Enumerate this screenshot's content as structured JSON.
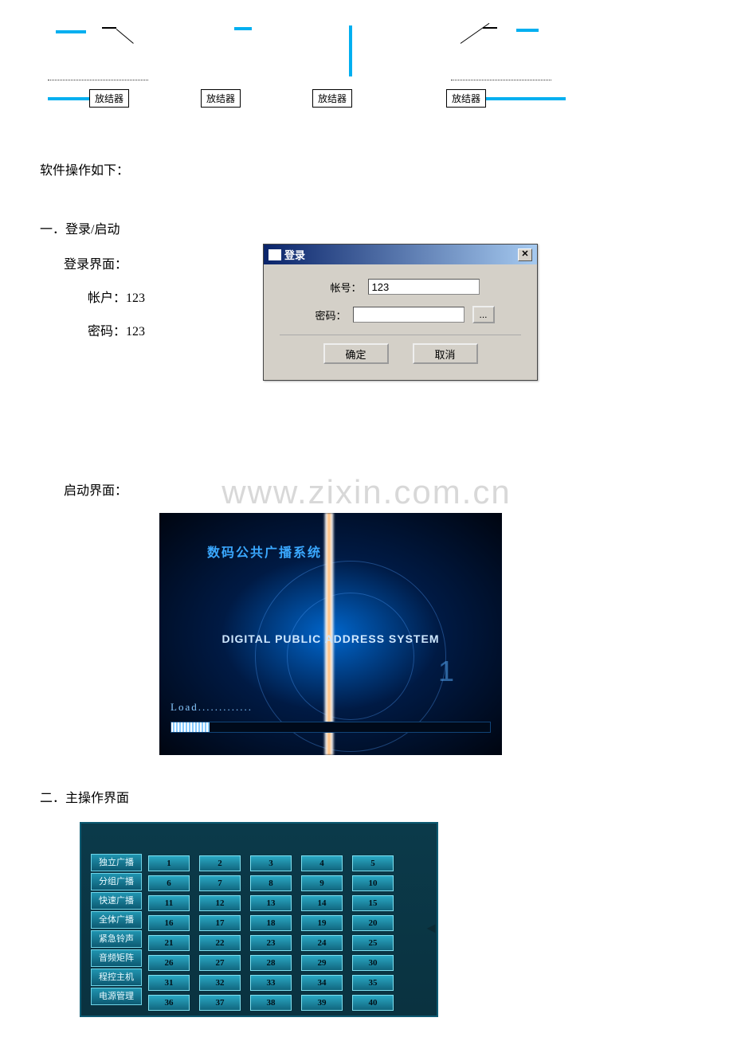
{
  "diagram": {
    "box_label": "放结器"
  },
  "intro": "软件操作如下：",
  "section1": {
    "title": "一．登录/启动",
    "login_label": "登录界面：",
    "account_label": "帐户：",
    "account_value": "123",
    "password_label": "密码：",
    "password_value": "123",
    "startup_label": "启动界面："
  },
  "login_dialog": {
    "title": "登录",
    "field_account": "帐号：",
    "field_password": "密码：",
    "account_input": "123",
    "password_input": "",
    "ok": "确定",
    "cancel": "取消",
    "ellipsis": "..."
  },
  "watermark": "www.zixin.com.cn",
  "splash": {
    "title_cn": "数码公共广播系统",
    "title_en": "DIGITAL PUBLIC ADDRESS SYSTEM",
    "loading": "Load.............",
    "number": "1"
  },
  "section2": {
    "title": "二．主操作界面"
  },
  "main_app": {
    "side_menu": [
      "独立广播",
      "分组广播",
      "快速广播",
      "全体广播",
      "紧急铃声",
      "音频矩阵",
      "程控主机",
      "电源管理"
    ],
    "grid_numbers": [
      1,
      2,
      3,
      4,
      5,
      6,
      7,
      8,
      9,
      10,
      11,
      12,
      13,
      14,
      15,
      16,
      17,
      18,
      19,
      20,
      21,
      22,
      23,
      24,
      25,
      26,
      27,
      28,
      29,
      30,
      31,
      32,
      33,
      34,
      35,
      36,
      37,
      38,
      39,
      40
    ]
  }
}
